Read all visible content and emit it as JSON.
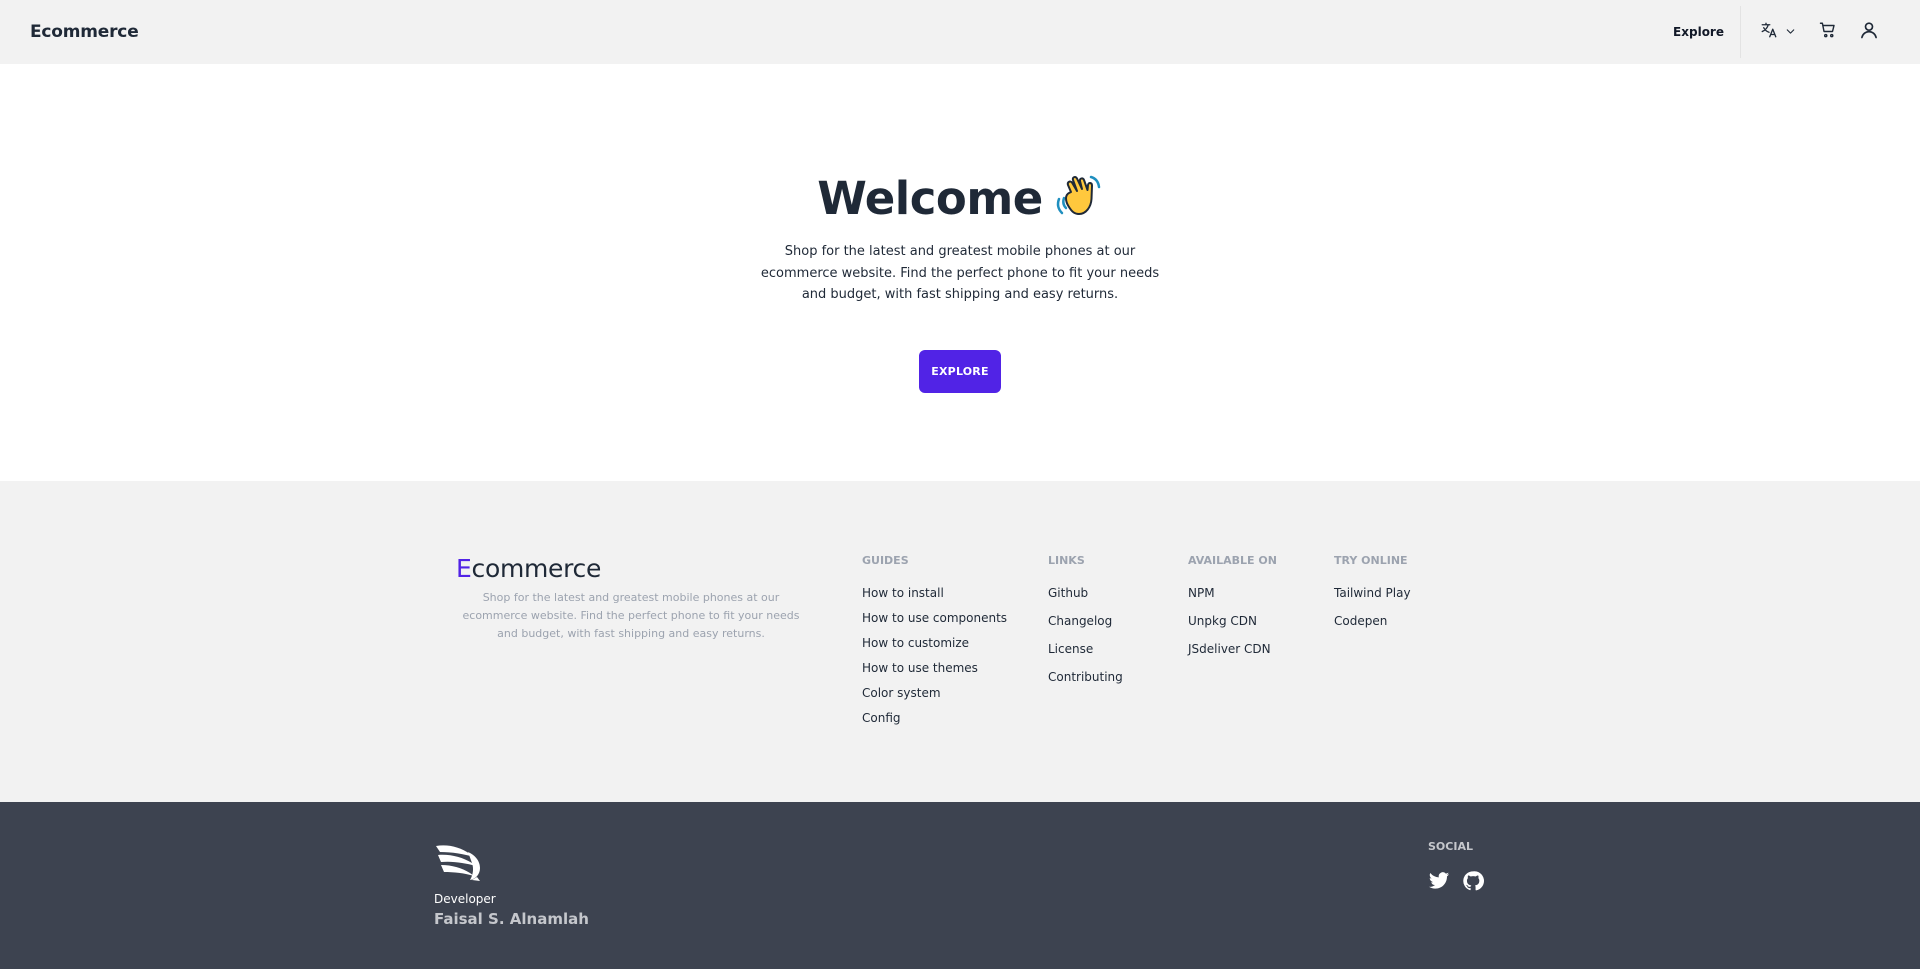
{
  "header": {
    "brand": "Ecommerce",
    "explore_label": "Explore",
    "icons": [
      "translate-icon",
      "chevron-down-icon",
      "cart-icon",
      "user-icon"
    ]
  },
  "hero": {
    "title": "Welcome",
    "emoji": "👋",
    "text": "Shop for the latest and greatest mobile phones at our ecommerce website. Find the perfect phone to fit your needs and budget, with fast shipping and easy returns.",
    "button_label": "EXPLORE",
    "accent_color": "#5123e6"
  },
  "footer": {
    "brand_first": "E",
    "brand_rest": "commerce",
    "brand_text": "Shop for the latest and greatest mobile phones at our ecommerce website. Find the perfect phone to fit your needs and budget, with fast shipping and easy returns.",
    "columns": [
      {
        "title": "GUIDES",
        "items": [
          "How to install",
          "How to use components",
          "How to customize",
          "How to use themes",
          "Color system",
          "Config"
        ]
      },
      {
        "title": "LINKS",
        "items": [
          "Github",
          "Changelog",
          "License",
          "Contributing"
        ]
      },
      {
        "title": "AVAILABLE ON",
        "items": [
          "NPM",
          "Unpkg CDN",
          "JSdeliver CDN"
        ]
      },
      {
        "title": "TRY ONLINE",
        "items": [
          "Tailwind Play",
          "Codepen"
        ]
      }
    ]
  },
  "bottom": {
    "developer_label": "Developer",
    "developer_name": "Faisal S. Alnamlah",
    "social_title": "SOCIAL",
    "social_icons": [
      "twitter-icon",
      "github-icon"
    ],
    "background_color": "#3d4350"
  }
}
